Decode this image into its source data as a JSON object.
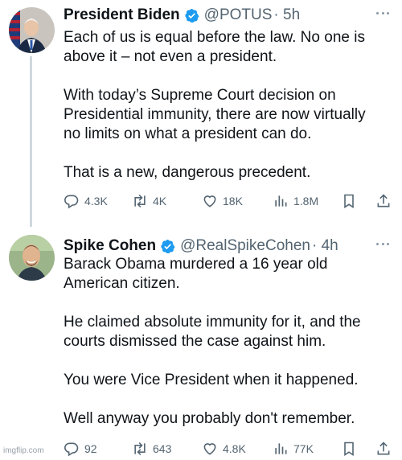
{
  "tweets": [
    {
      "name": "President Biden",
      "handle": "@POTUS",
      "time": "· 5h",
      "text": "Each of us is equal before the law. No one is\nabove it – not even a president.\n\nWith today’s Supreme Court decision on\nPresidential immunity, there are now virtually\nno limits on what a president can do.\n\nThat is a new, dangerous precedent.",
      "replies": "4.3K",
      "reposts": "4K",
      "likes": "18K",
      "views": "1.8M"
    },
    {
      "name": "Spike Cohen",
      "handle": "@RealSpikeCohen",
      "time": "· 4h",
      "text": "Barack Obama murdered a 16 year old\nAmerican citizen.\n\nHe claimed absolute immunity for it, and the\ncourts dismissed the case against him.\n\nYou were Vice President when it happened.\n\nWell anyway you probably don't remember.",
      "replies": "92",
      "reposts": "643",
      "likes": "4.8K",
      "views": "77K"
    }
  ],
  "icons": {
    "verified": "verified-badge-icon",
    "reply": "reply-icon",
    "repost": "repost-icon",
    "like": "heart-icon",
    "views": "views-bar-icon",
    "bookmark": "bookmark-icon",
    "share": "share-icon",
    "more": "more-icon"
  },
  "colors": {
    "verified": "#1d9bf0",
    "secondary_text": "#536471",
    "thread_line": "#cfd9de"
  },
  "watermark": "imgflip.com"
}
